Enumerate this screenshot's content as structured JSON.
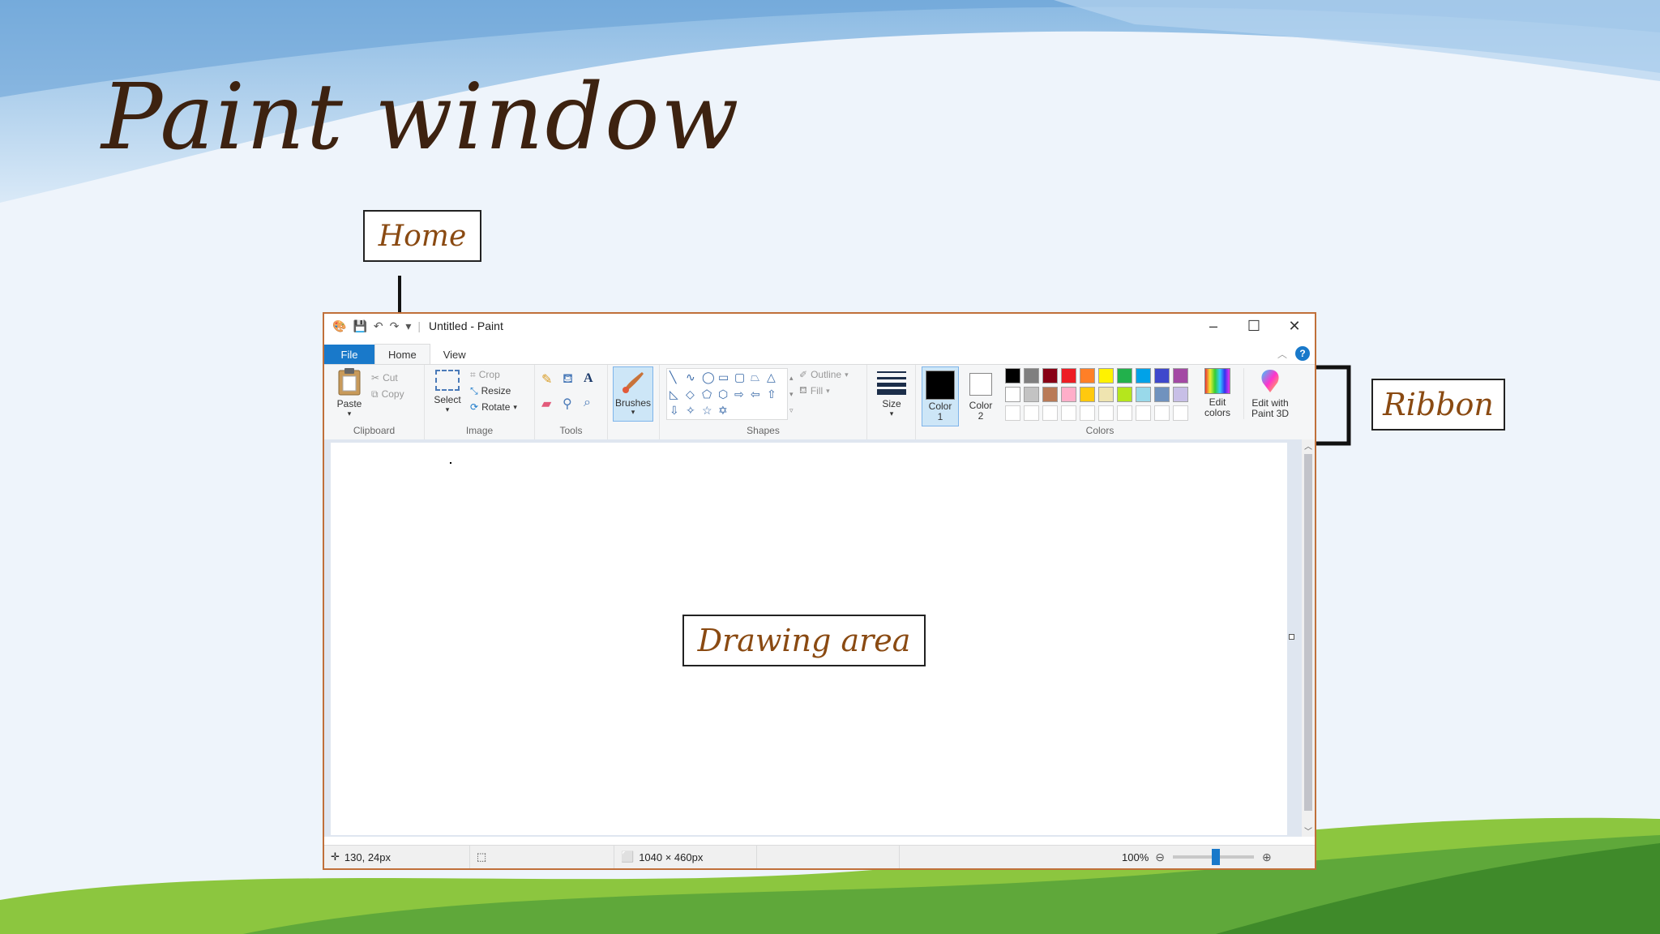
{
  "slide": {
    "title": "Paint window",
    "callouts": {
      "home": "Home",
      "ribbon": "Ribbon",
      "drawing_area": "Drawing area"
    }
  },
  "paint": {
    "window_title": "Untitled - Paint",
    "tabs": {
      "file": "File",
      "home": "Home",
      "view": "View"
    },
    "clipboard": {
      "paste": "Paste",
      "cut": "Cut",
      "copy": "Copy",
      "label": "Clipboard"
    },
    "image": {
      "select": "Select",
      "crop": "Crop",
      "resize": "Resize",
      "rotate": "Rotate",
      "label": "Image"
    },
    "tools": {
      "label": "Tools"
    },
    "brushes": {
      "label": "Brushes"
    },
    "shapes": {
      "outline": "Outline",
      "fill": "Fill",
      "label": "Shapes"
    },
    "size": {
      "label": "Size"
    },
    "color1": {
      "line1": "Color",
      "line2": "1"
    },
    "color2": {
      "line1": "Color",
      "line2": "2"
    },
    "colors": {
      "label": "Colors",
      "row1": [
        "#000000",
        "#7f7f7f",
        "#880015",
        "#ed1c24",
        "#ff7f27",
        "#fff200",
        "#22b14c",
        "#00a2e8",
        "#3f48cc",
        "#a349a4"
      ],
      "row2": [
        "#ffffff",
        "#c3c3c3",
        "#b97a57",
        "#ffaec9",
        "#ffc90e",
        "#efe4b0",
        "#b5e61d",
        "#99d9ea",
        "#7092be",
        "#c8bfe7"
      ]
    },
    "edit_colors": {
      "line1": "Edit",
      "line2": "colors"
    },
    "paint3d": {
      "line1": "Edit with",
      "line2": "Paint 3D"
    },
    "status": {
      "cursor": "130, 24px",
      "canvas_size": "1040 × 460px",
      "zoom": "100%"
    }
  }
}
